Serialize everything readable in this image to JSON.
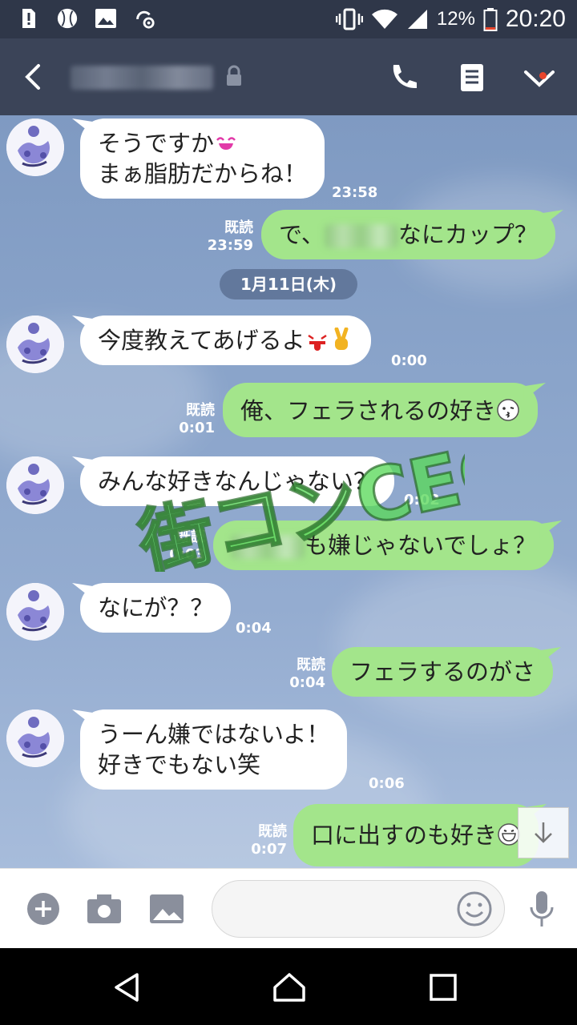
{
  "status_bar": {
    "battery": "12%",
    "time": "20:20",
    "icons": [
      "alert-icon",
      "baseball-icon",
      "gallery-icon",
      "settings-sync-icon",
      "vibrate-icon",
      "wifi-icon",
      "signal-icon",
      "battery-icon"
    ]
  },
  "header": {
    "icons": [
      "back-icon",
      "lock-icon",
      "phone-icon",
      "notes-icon",
      "chevron-down-icon"
    ]
  },
  "date_separator": "1月11日(木)",
  "messages": [
    {
      "side": "in",
      "lines": [
        "そうですか",
        "まぁ脂肪だからね！"
      ],
      "time": "23:58"
    },
    {
      "side": "out",
      "text_pre": "で、",
      "text_post": "なにカップ？",
      "read": "既読",
      "time": "23:59"
    },
    {
      "side": "in",
      "text": "今度教えてあげるよ",
      "time": "0:00"
    },
    {
      "side": "out",
      "text": "俺、フェラされるの好き",
      "read": "既読",
      "time": "0:01"
    },
    {
      "side": "in",
      "text": "みんな好きなんじゃない？",
      "time": "0:02"
    },
    {
      "side": "out",
      "text_post": "も嫌じゃないでしょ？",
      "read": "既読",
      "time": "0:03"
    },
    {
      "side": "in",
      "text": "なにが？？",
      "time": "0:04"
    },
    {
      "side": "out",
      "text": "フェラするのがさ",
      "read": "既読",
      "time": "0:04"
    },
    {
      "side": "in",
      "lines": [
        "うーん嫌ではないよ！",
        "好きでもない笑"
      ],
      "time": "0:06"
    },
    {
      "side": "out",
      "text": "口に出すのも好き",
      "read": "既読",
      "time": "0:07"
    }
  ],
  "watermark": "街コンCEO",
  "input_bar": {
    "icons": [
      "plus-icon",
      "camera-icon",
      "image-icon",
      "emoji-icon",
      "mic-icon"
    ],
    "placeholder": ""
  },
  "nav_bar": {
    "icons": [
      "back-triangle-icon",
      "home-icon",
      "recents-icon"
    ]
  },
  "colors": {
    "header": "#3b4458",
    "status_bar": "#2f3749",
    "outgoing": "#a3e58b",
    "incoming": "#ffffff"
  }
}
